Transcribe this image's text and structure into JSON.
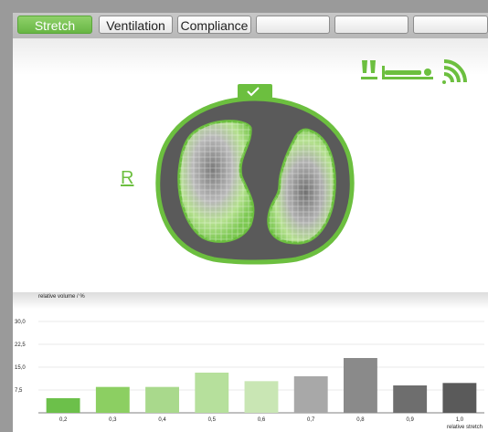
{
  "tabs": [
    {
      "label": "Stretch",
      "active": true
    },
    {
      "label": "Ventilation",
      "active": false
    },
    {
      "label": "Compliance",
      "active": false
    },
    {
      "label": "",
      "active": false
    },
    {
      "label": "",
      "active": false
    },
    {
      "label": "",
      "active": false
    }
  ],
  "lung_view": {
    "side_label": "R",
    "confirm_icon": "check-icon",
    "status_icons": [
      "feet-icon",
      "patient-supine-icon",
      "wireless-signal-icon"
    ],
    "accent_color": "#6cbf3f"
  },
  "chart_data": {
    "type": "bar",
    "ylabel": "relative volume / %",
    "xlabel": "relative stretch",
    "ylim": [
      0,
      30
    ],
    "yticks": [
      "7,5",
      "15,0",
      "22,5",
      "30,0"
    ],
    "categories": [
      "0,2",
      "0,3",
      "0,4",
      "0,5",
      "0,6",
      "0,7",
      "0,8",
      "0,9",
      "1,0"
    ],
    "values": [
      4.8,
      8.5,
      8.5,
      13.2,
      10.4,
      12.0,
      18.0,
      9.0,
      9.8
    ],
    "colors": [
      "#6cc04a",
      "#8ccf62",
      "#a9d98c",
      "#b6e09c",
      "#c9e6b4",
      "#a8a8a8",
      "#8a8a8a",
      "#6e6e6e",
      "#5a5a5a"
    ]
  }
}
